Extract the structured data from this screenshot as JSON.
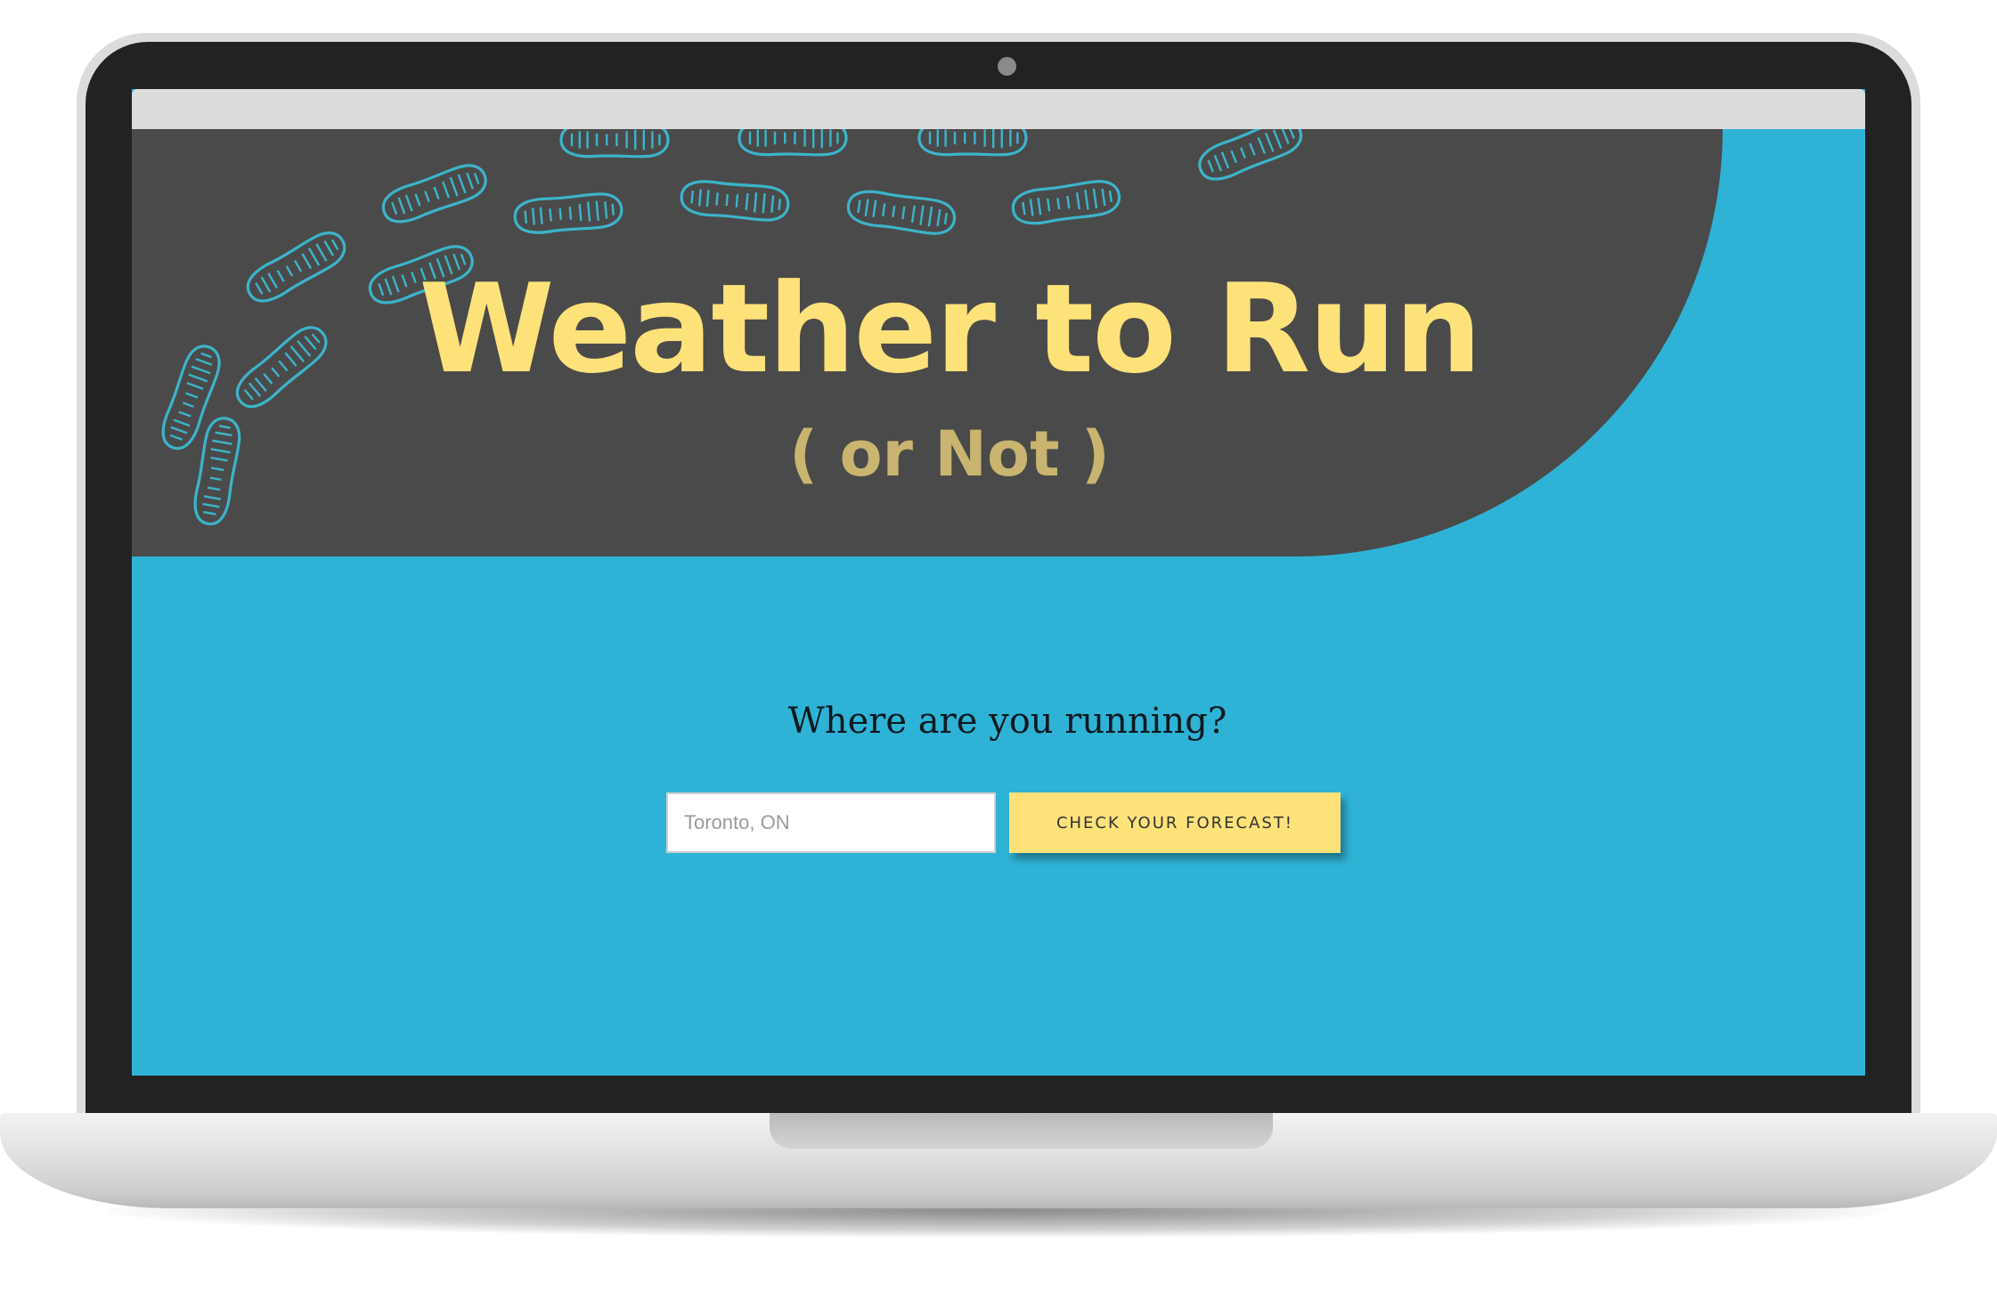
{
  "header": {
    "title": "Weather to Run",
    "subtitle": "( or Not )"
  },
  "search": {
    "question": "Where are you running?",
    "placeholder": "Toronto, ON",
    "button_label": "CHECK YOUR FORECAST!"
  },
  "colors": {
    "page_background": "#2eb3d6",
    "header_background": "#4a4a4a",
    "title": "#fde27a",
    "subtitle": "#c9b56f",
    "button": "#fde27a",
    "footprint": "#3cb4c9"
  },
  "icons": {
    "decoration": "shoe-footprint-icon"
  }
}
